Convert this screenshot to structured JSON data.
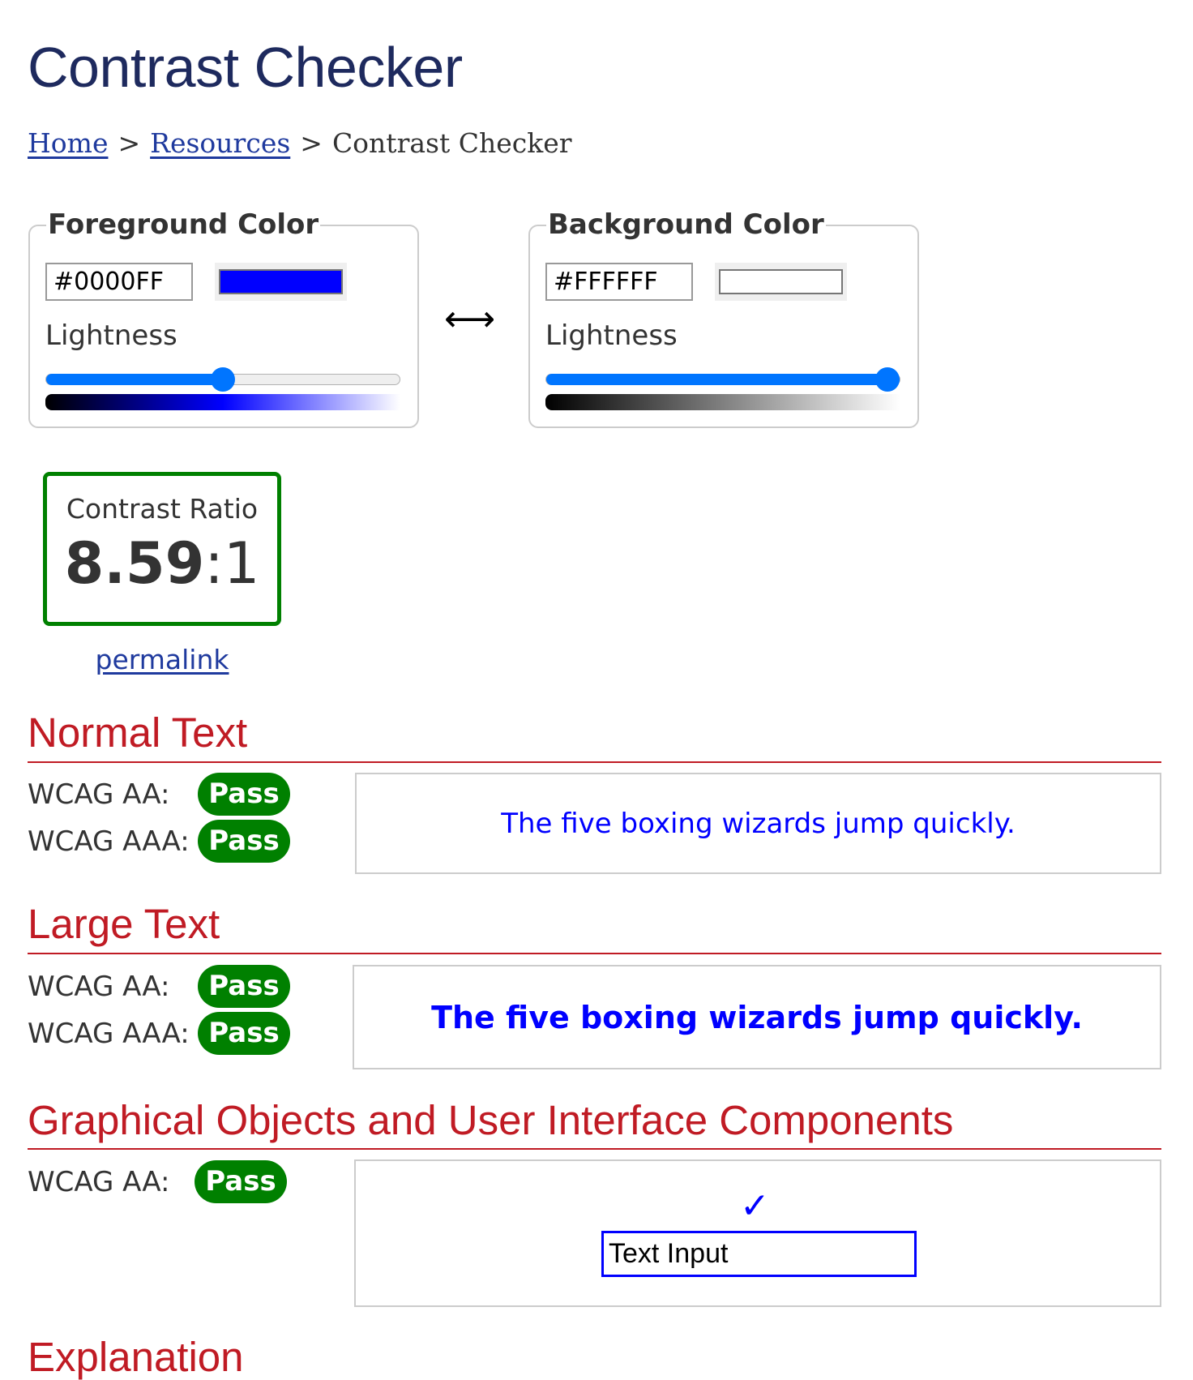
{
  "page": {
    "title": "Contrast Checker",
    "breadcrumb": [
      {
        "label": "Home",
        "link": true
      },
      {
        "label": ">",
        "link": false
      },
      {
        "label": "Resources",
        "link": true
      },
      {
        "label": ">",
        "link": false
      },
      {
        "label": "Contrast Checker",
        "link": false
      }
    ]
  },
  "foreground": {
    "legend": "Foreground Color",
    "hex_value": "#0000FF",
    "swatch_color": "#0000FF",
    "lightness_label": "Lightness",
    "lightness_percent": 50,
    "gradient": [
      "#000000",
      "#0000ff",
      "#ffffff"
    ]
  },
  "swap": {
    "icon": "left-right-arrow-icon",
    "glyph": "⟷"
  },
  "background": {
    "legend": "Background Color",
    "hex_value": "#FFFFFF",
    "swatch_color": "#FFFFFF",
    "lightness_label": "Lightness",
    "lightness_percent": 100,
    "gradient": [
      "#000000",
      "#808080",
      "#ffffff"
    ]
  },
  "contrast": {
    "label": "Contrast Ratio",
    "ratio": "8.59",
    "suffix": ":1",
    "permalink_label": "permalink",
    "status_color": "#008000"
  },
  "sections": {
    "normal_text": {
      "title": "Normal Text",
      "results": [
        {
          "label": "WCAG AA:",
          "status": "Pass"
        },
        {
          "label": "WCAG AAA:",
          "status": "Pass"
        }
      ],
      "sample": "The five boxing wizards jump quickly."
    },
    "large_text": {
      "title": "Large Text",
      "results": [
        {
          "label": "WCAG AA:",
          "status": "Pass"
        },
        {
          "label": "WCAG AAA:",
          "status": "Pass"
        }
      ],
      "sample": "The five boxing wizards jump quickly."
    },
    "graphical": {
      "title": "Graphical Objects and User Interface Components",
      "results": [
        {
          "label": "WCAG AA:",
          "status": "Pass"
        }
      ],
      "check_glyph": "✓",
      "text_input_value": "Text Input"
    },
    "explanation": {
      "title": "Explanation"
    }
  },
  "colors": {
    "title": "#1e2a5e",
    "section_heading": "#c01b24",
    "pass": "#008000",
    "link": "#1f3a9e",
    "slider_accent": "#0075ff"
  }
}
